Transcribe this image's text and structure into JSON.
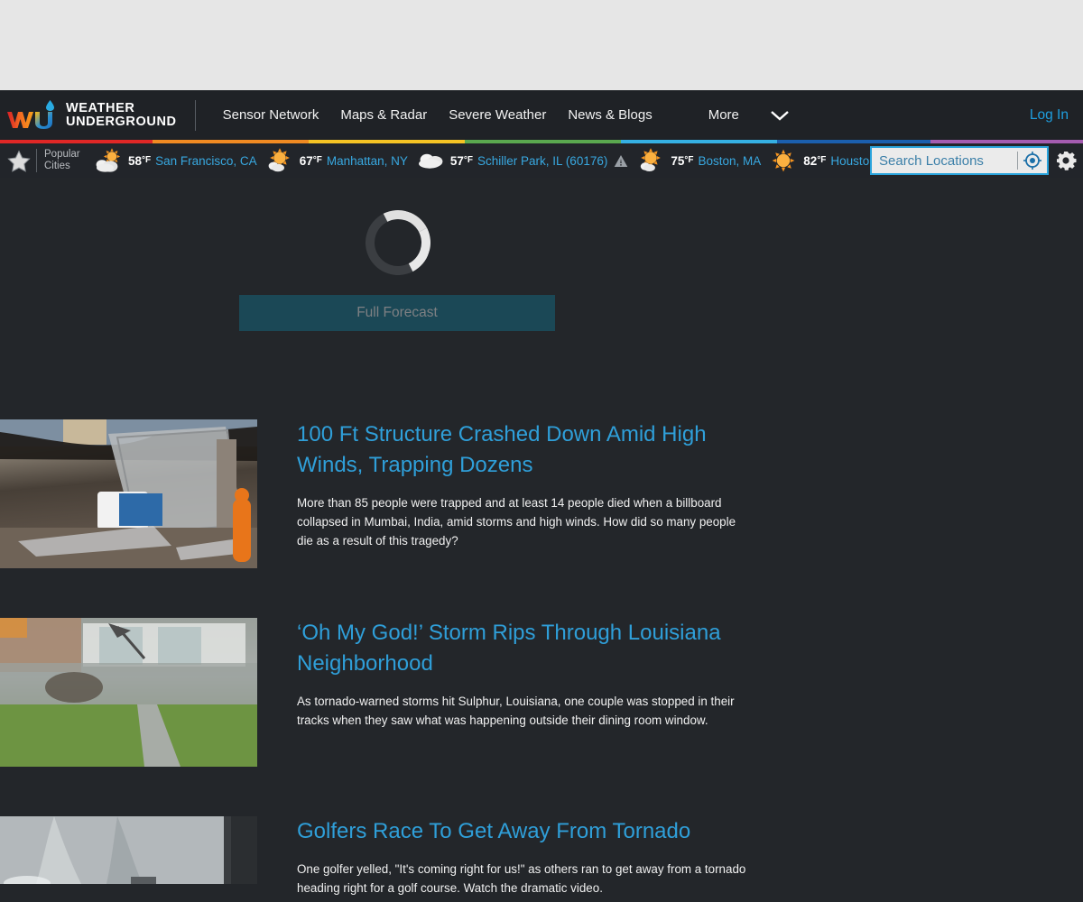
{
  "colors": {
    "page_bg": "#23262a",
    "header_bg": "#1f2226",
    "link_blue": "#2f9fd9",
    "city_blue": "#38a8e0",
    "accent_cyan": "#29a3dc",
    "button_teal": "#1b4856",
    "top_strip": "#e6e6e6"
  },
  "header": {
    "logo_line1": "WEATHER",
    "logo_line2": "UNDERGROUND",
    "logo_icon": "weather-underground-wu-logo",
    "nav": [
      {
        "label": "Sensor Network"
      },
      {
        "label": "Maps & Radar"
      },
      {
        "label": "Severe Weather"
      },
      {
        "label": "News & Blogs"
      },
      {
        "label": "More"
      }
    ],
    "more_chevron_icon": "chevron-down-icon",
    "login_label": "Log In"
  },
  "rainbow": [
    "#e02726",
    "#f08a22",
    "#f5c324",
    "#5aa84f",
    "#35b0e3",
    "#1b5fae",
    "#a45cb0"
  ],
  "citybar": {
    "star_icon": "star-icon",
    "popular_cities_label_line1": "Popular",
    "popular_cities_label_line2": "Cities",
    "cities": [
      {
        "temp": "58",
        "unit": "°F",
        "name": "San Francisco, CA",
        "icon": "partly-cloudy-icon",
        "alert": false
      },
      {
        "temp": "67",
        "unit": "°F",
        "name": "Manhattan, NY",
        "icon": "mostly-sunny-icon",
        "alert": false
      },
      {
        "temp": "57",
        "unit": "°F",
        "name": "Schiller Park, IL (60176)",
        "icon": "cloudy-icon",
        "alert": true,
        "alert_icon": "warning-triangle-icon"
      },
      {
        "temp": "75",
        "unit": "°F",
        "name": "Boston, MA",
        "icon": "mostly-sunny-icon",
        "alert": false
      },
      {
        "temp": "82",
        "unit": "°F",
        "name": "Houston, TX",
        "icon": "sunny-icon",
        "alert": false
      }
    ],
    "search": {
      "value": "",
      "placeholder": "Search Locations",
      "gps_icon": "gps-crosshair-icon"
    },
    "settings_icon": "gear-icon"
  },
  "forecast": {
    "loading_spinner_icon": "loading-spinner-icon",
    "full_forecast_label": "Full Forecast"
  },
  "articles": [
    {
      "title": "100 Ft Structure Crashed Down Amid High Winds, Trapping Dozens",
      "desc": "More than 85 people were trapped and at least 14 people died when a billboard collapsed in Mumbai, India, amid storms and high winds. How did so many people die as a result of this tragedy?",
      "thumb_class": "thumb-collapse",
      "thumb_name": "article-thumbnail-collapsed-billboard"
    },
    {
      "title": "‘Oh My God!’ Storm Rips Through Louisiana Neighborhood",
      "desc": "As tornado-warned storms hit Sulphur, Louisiana, one couple was stopped in their tracks when they saw what was happening outside their dining room window.",
      "thumb_class": "thumb-storm",
      "thumb_name": "article-thumbnail-storm-neighborhood"
    },
    {
      "title": "Golfers Race To Get Away From Tornado",
      "desc": "One golfer yelled, \"It's coming right for us!\" as others ran to get away from a tornado heading right for a golf course. Watch the dramatic video.",
      "thumb_class": "thumb-tornado",
      "thumb_name": "article-thumbnail-tornado-golf-course"
    }
  ]
}
